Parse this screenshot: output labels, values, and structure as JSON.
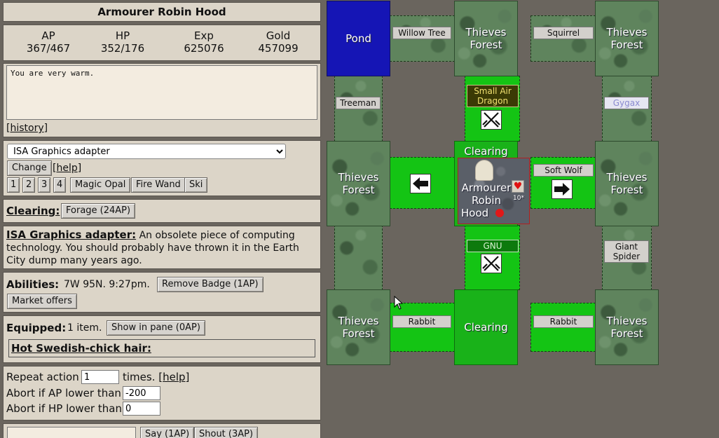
{
  "character": {
    "title": "Armourer Robin Hood"
  },
  "stats": [
    {
      "label": "AP",
      "value": "367/467"
    },
    {
      "label": "HP",
      "value": "352/176"
    },
    {
      "label": "Exp",
      "value": "625076"
    },
    {
      "label": "Gold",
      "value": "457099"
    }
  ],
  "messages": {
    "text": "You are very warm.",
    "history_link": "history"
  },
  "item_select": {
    "selected": "ISA Graphics adapter",
    "change_label": "Change",
    "help_link": "help",
    "quick_slots": [
      "1",
      "2",
      "3",
      "4"
    ],
    "quick_items": [
      "Magic Opal",
      "Fire Wand",
      "Ski"
    ]
  },
  "location": {
    "name": "Clearing:",
    "forage_label": "Forage (24AP)"
  },
  "item_desc": {
    "name": "ISA Graphics adapter:",
    "text": "An obsolete piece of computing technology. You should probably have thrown it in the Earth City dump many years ago."
  },
  "abilities": {
    "label": "Abilities:",
    "text": "7W 95N. 9:27pm.",
    "remove_badge_label": "Remove Badge (1AP)",
    "market_label": "Market offers"
  },
  "equipped": {
    "label": "Equipped:",
    "count_text": "1 item.",
    "show_label": "Show in pane (0AP)",
    "item": "Hot Swedish-chick hair:"
  },
  "repeat": {
    "prefix": "Repeat action",
    "value": "1",
    "suffix": "times.",
    "help_link": "help",
    "abort_ap_label": "Abort if AP lower than",
    "abort_ap_value": "-200",
    "abort_hp_label": "Abort if HP lower than",
    "abort_hp_value": "0"
  },
  "chat": {
    "say_label": "Say (1AP)",
    "shout_label": "Shout (3AP)"
  },
  "map": {
    "tiles": {
      "pond": "Pond",
      "forest_nw": [
        "Thieves",
        "Forest"
      ],
      "forest_ne": [
        "Thieves",
        "Forest"
      ],
      "forest_w": [
        "Thieves",
        "Forest"
      ],
      "forest_e": [
        "Thieves",
        "Forest"
      ],
      "forest_sw": [
        "Thieves",
        "Forest"
      ],
      "forest_se": [
        "Thieves",
        "Forest"
      ],
      "center_title": "Clearing",
      "center_player": [
        "Armourer",
        "Robin",
        "Hood"
      ],
      "center_badge": "10*",
      "south": "Clearing"
    },
    "creatures": {
      "willow_tree": "Willow Tree",
      "squirrel": "Squirrel",
      "treeman": "Treeman",
      "small_air_dragon": [
        "Small Air",
        "Dragon"
      ],
      "gygax": "Gygax",
      "soft_wolf": "Soft Wolf",
      "gnu": "GNU",
      "giant_spider": [
        "Giant",
        "Spider"
      ],
      "rabbit_w": "Rabbit",
      "rabbit_e": "Rabbit"
    }
  },
  "colors": {
    "panel_bg": "#dcd5c8",
    "page_bg": "#6a655e",
    "clearing_green": "#19b219",
    "pond_blue": "#1515b5",
    "dragon_label_bg": "#3b3a05",
    "gnu_label_bg": "#0d7a0d"
  }
}
